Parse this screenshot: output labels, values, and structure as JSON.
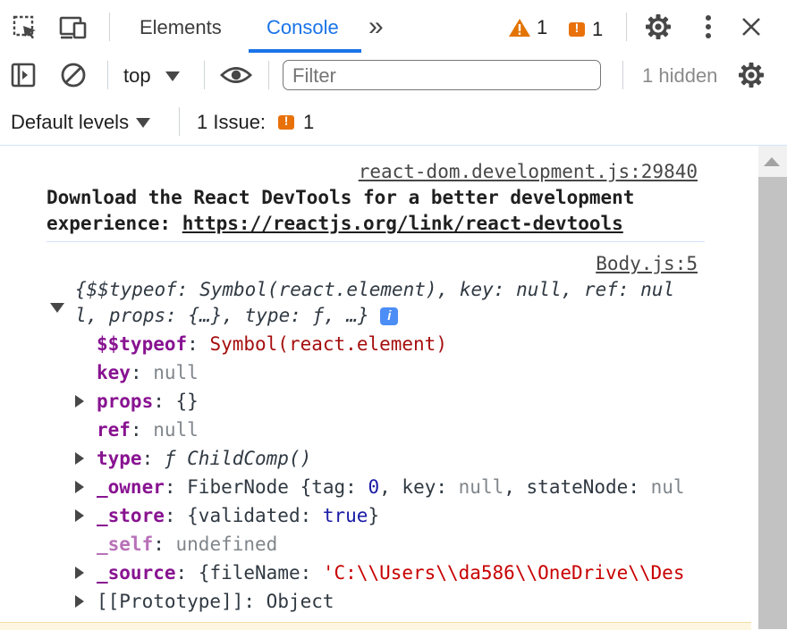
{
  "tabs": {
    "elements": "Elements",
    "console": "Console",
    "more": "»",
    "warnings_count": "1",
    "issues_count": "1"
  },
  "toolbar": {
    "context": "top",
    "filter_placeholder": "Filter",
    "hidden": "1 hidden",
    "levels": "Default levels",
    "issue_label": "1 Issue:",
    "issue_count": "1"
  },
  "console": {
    "msg1": {
      "source": "react-dom.development.js:29840",
      "line1": "Download the React DevTools for a better development",
      "line2_prefix": "experience: ",
      "line2_link": "https://reactjs.org/link/react-devtools"
    },
    "msg2": {
      "source": "Body.js:5",
      "summary1": "{$$typeof: Symbol(react.element), key: null, ref: nul",
      "summary2": "l, props: {…}, type: ƒ, …}",
      "info": "i",
      "props": [
        {
          "key": "$$typeof",
          "value": "Symbol(react.element)"
        },
        {
          "key": "key",
          "value": "null"
        },
        {
          "key": "props",
          "value": "{}"
        },
        {
          "key": "ref",
          "value": "null"
        },
        {
          "key": "type",
          "value": "ƒ ChildComp()"
        },
        {
          "key": "_owner",
          "value": "FiberNode {tag: 0, key: null, stateNode: nul"
        },
        {
          "key": "_store",
          "value": "{validated: true}"
        },
        {
          "key": "_self",
          "value": "undefined"
        },
        {
          "key": "_source",
          "value": "{fileName: 'C:\\\\Users\\\\da586\\\\OneDrive\\\\Des"
        },
        {
          "key": "[[Prototype]]",
          "value": "Object"
        }
      ]
    }
  },
  "colors": {
    "accent": "#1a73e8",
    "warning": "#e37400",
    "issue": "#e8710a"
  }
}
